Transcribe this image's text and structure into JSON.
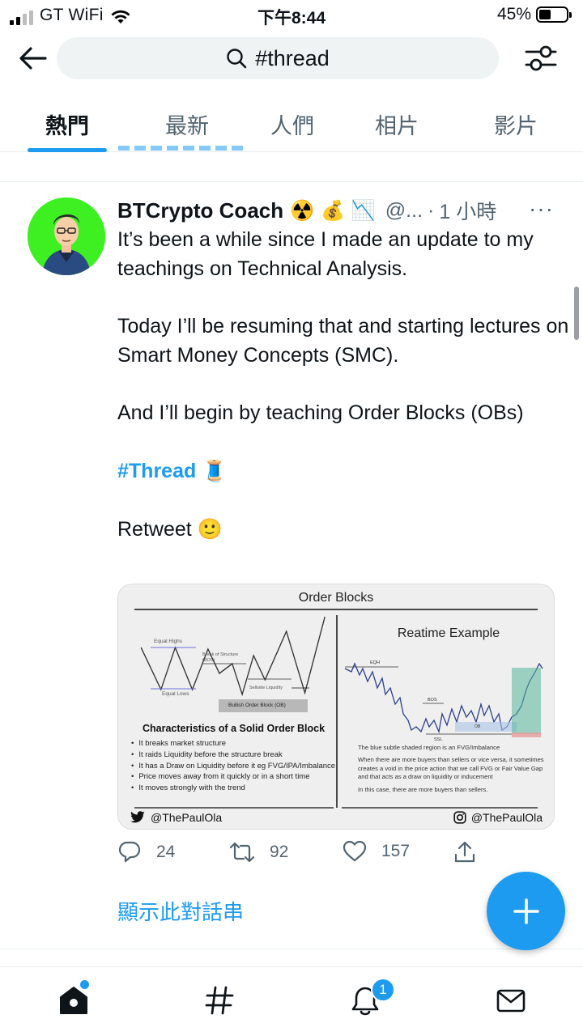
{
  "status_bar": {
    "carrier": "GT WiFi",
    "time": "下午8:44",
    "battery_percent": "45%",
    "battery_level": 0.45,
    "signal_bars_active": 2
  },
  "search": {
    "query": "#thread"
  },
  "tabs": [
    {
      "label": "熱門",
      "active": true
    },
    {
      "label": "最新",
      "active": false
    },
    {
      "label": "人們",
      "active": false
    },
    {
      "label": "相片",
      "active": false
    },
    {
      "label": "影片",
      "active": false
    }
  ],
  "tweet": {
    "display_name": "BTCrypto Coach",
    "name_emojis": [
      "☢️",
      "💰",
      "📉"
    ],
    "handle": "@...",
    "separator": "·",
    "timestamp": "1 小時",
    "more": "···",
    "paragraphs": [
      "It’s been a while since I made an update to my teachings on Technical Analysis.",
      "Today I’ll be resuming that and starting lectures on Smart Money Concepts (SMC).",
      "And I’ll begin by teaching Order Blocks (OBs)"
    ],
    "hashtag": "#Thread",
    "hashtag_emoji": "🧵",
    "closing": "Retweet",
    "closing_emoji": "🙂",
    "media": {
      "title": "Order Blocks",
      "left_labels": {
        "equal_highs": "Equal Highs",
        "equal_lows": "Equal Lows",
        "bos": "Break of Structure (BOS)",
        "sellside": "Sellside Liquidity",
        "ob": "Bullish Order Block (OB)"
      },
      "characteristics_title": "Characteristics of a Solid Order Block",
      "bullets": [
        "It breaks market structure",
        "It raids Liquidity before the structure break",
        "It has a Draw on Liquidity before it eg FVG/IPA/Imbalance",
        "Price moves away from it quickly or in a short time",
        "It moves strongly with the trend"
      ],
      "right_title": "Reatime Example",
      "right_labels": {
        "eqh": "EQH",
        "bos": "BOS",
        "ssl": "SSL",
        "ob": "OB"
      },
      "notes": [
        "The blue subtle shaded region is an FVG/Imbalance",
        "When there are more buyers than sellers or vice versa, it sometimes creates a void in the price action that we call FVG or Fair Value Gap and that acts as a draw on liquidity or inducement",
        "In this case, there are more buyers than sellers."
      ],
      "credit_left": "@ThePaulOla",
      "credit_right": "@ThePaulOla"
    },
    "counts": {
      "replies": "24",
      "retweets": "92",
      "likes": "157"
    },
    "show_thread": "顯示此對話串"
  },
  "bottom_nav": {
    "notifications_badge": "1"
  },
  "colors": {
    "accent": "#1d9bf0",
    "text": "#0f1419",
    "muted": "#536471",
    "avatar_bg": "#3ef022"
  }
}
